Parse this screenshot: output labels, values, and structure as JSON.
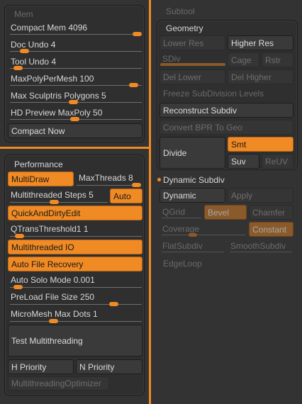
{
  "left": {
    "mem": {
      "title": "Mem",
      "compact_mem": {
        "label": "Compact Mem 4096",
        "value": 1.0
      },
      "doc_undo": {
        "label": "Doc Undo 4",
        "value": 0.08
      },
      "tool_undo": {
        "label": "Tool Undo 4",
        "value": 0.03
      },
      "max_poly_per_mesh": {
        "label": "MaxPolyPerMesh 100",
        "value": 0.97
      },
      "max_sculptris_polygons": {
        "label": "Max Sculptris Polygons 5",
        "value": 0.48
      },
      "hd_preview_maxpoly": {
        "label": "HD Preview MaxPoly 50",
        "value": 0.49
      },
      "compact_now": "Compact Now"
    },
    "performance": {
      "title": "Performance",
      "multidraw": "MultiDraw",
      "max_threads": {
        "label": "MaxThreads 8",
        "value": 1.0
      },
      "multithreaded_steps": {
        "label": "Multithreaded Steps 5",
        "value": 0.45
      },
      "auto": "Auto",
      "quick_and_dirty_edit": "QuickAndDirtyEdit",
      "qtrans_threshold": {
        "label": "QTransThreshold1 1",
        "value": 0.04
      },
      "multithreaded_io": "Multithreaded IO",
      "auto_file_recovery": "Auto File Recovery",
      "auto_solo_mode": {
        "label": "Auto Solo Mode 0.001",
        "value": 0.03
      },
      "preload_file_size": {
        "label": "PreLoad File Size 250",
        "value": 0.81
      },
      "micromesh_max_dots": {
        "label": "MicroMesh Max Dots 1",
        "value": 0.32
      },
      "test_multithreading": "Test Multithreading",
      "h_priority": "H Priority",
      "n_priority": "N Priority",
      "multithreading_optimizer": "MultithreadingOptimizer"
    }
  },
  "right": {
    "subtool": "Subtool",
    "geometry": {
      "title": "Geometry",
      "lower_res": "Lower Res",
      "higher_res": "Higher Res",
      "sdiv": "SDiv",
      "cage": "Cage",
      "rstr": "Rstr",
      "del_lower": "Del Lower",
      "del_higher": "Del Higher",
      "freeze_subdivision_levels": "Freeze SubDivision Levels",
      "reconstruct_subdiv": "Reconstruct Subdiv",
      "convert_bpr_to_geo": "Convert BPR To Geo",
      "divide": "Divide",
      "smt": "Smt",
      "suv": "Suv",
      "reuv": "ReUV"
    },
    "dynamic_subdiv": {
      "title": "Dynamic Subdiv",
      "dynamic": "Dynamic",
      "apply": "Apply",
      "qgrid": "QGrid",
      "bevel": "Bevel",
      "chamfer": "Chamfer",
      "coverage": "Coverage",
      "constant": "Constant",
      "flatsubdiv": "FlatSubdiv",
      "smoothsubdiv": "SmoothSubdiv",
      "edgeloop": "EdgeLoop"
    }
  },
  "colors": {
    "accent": "#f08a24",
    "panel": "#333333",
    "button": "#3a3a3a"
  }
}
